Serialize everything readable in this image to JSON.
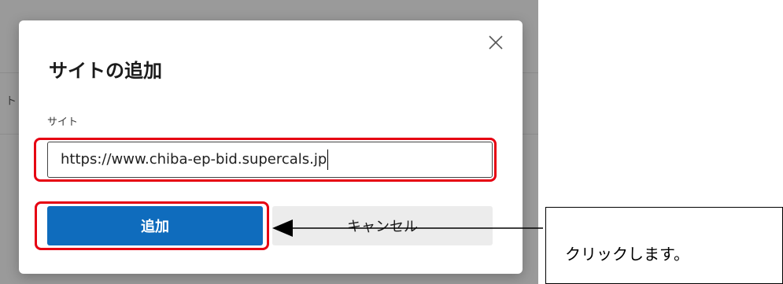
{
  "dialog": {
    "title": "サイトの追加",
    "site_label": "サイト",
    "site_value": "https://www.chiba-ep-bid.supercals.jp",
    "add_label": "追加",
    "cancel_label": "キャンセル",
    "close_icon": "close-icon"
  },
  "background": {
    "partial_glyph": "ト"
  },
  "annotation": {
    "callout_text": "クリックします。"
  },
  "colors": {
    "primary_button": "#0f6cbd",
    "highlight": "#e60012",
    "overlay": "#8a8a8a"
  }
}
